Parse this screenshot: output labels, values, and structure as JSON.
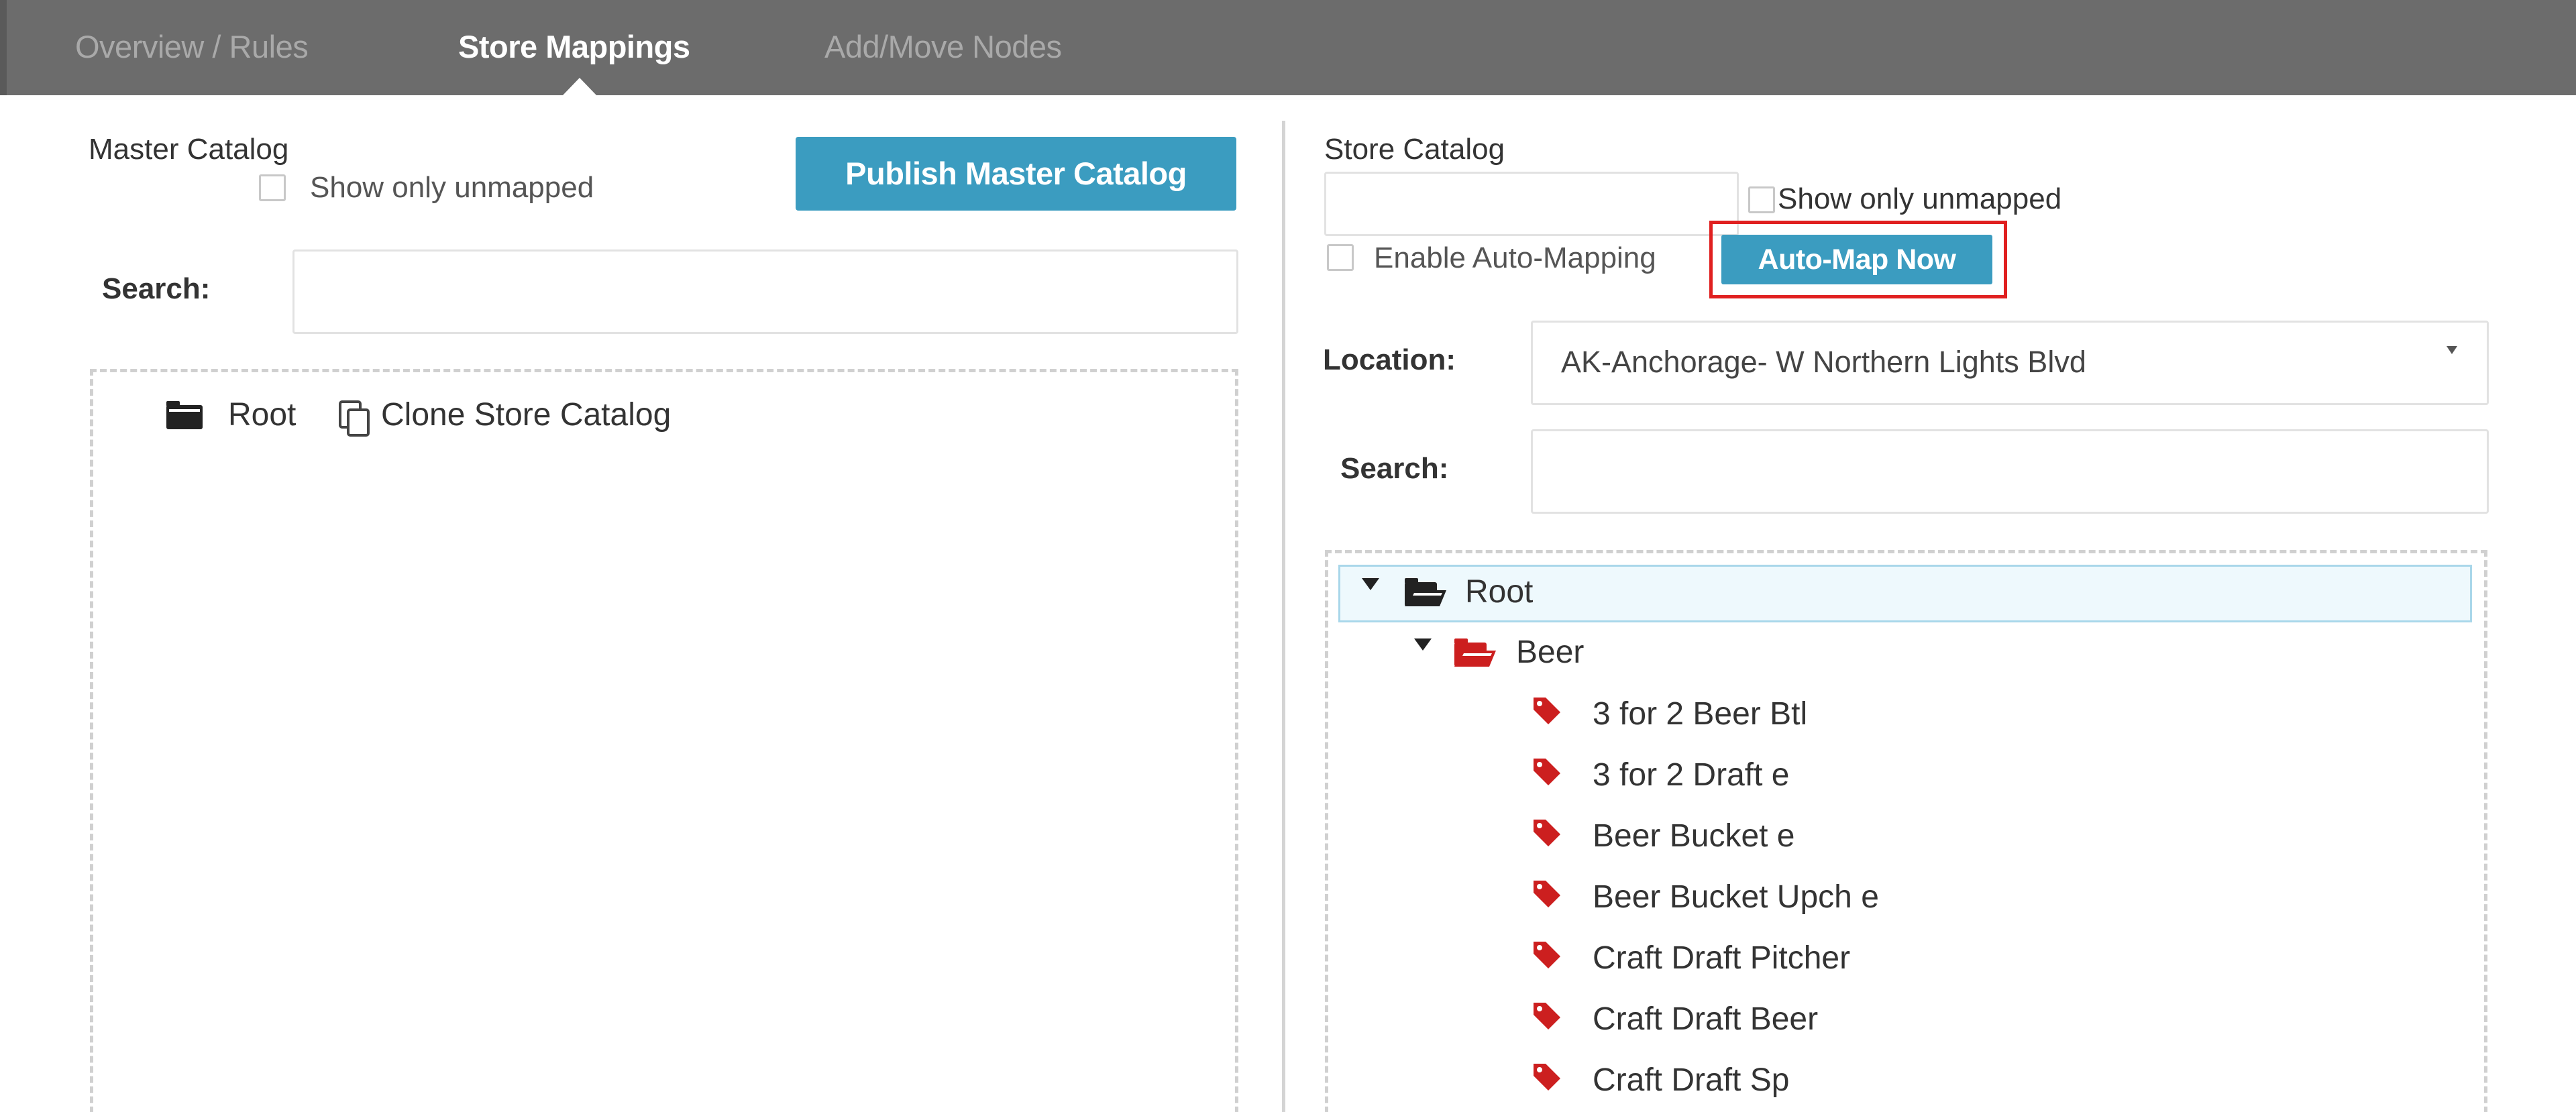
{
  "tabs": [
    {
      "label": "Overview / Rules",
      "active": false
    },
    {
      "label": "Store Mappings",
      "active": true
    },
    {
      "label": "Add/Move Nodes",
      "active": false
    }
  ],
  "master": {
    "title": "Master Catalog",
    "show_unmapped_label": "Show only unmapped",
    "publish_button": "Publish Master Catalog",
    "search_label": "Search:",
    "search_value": "",
    "tree_root": "Root",
    "clone_label": "Clone Store Catalog"
  },
  "store": {
    "title": "Store Catalog",
    "catalog_input_value": "",
    "show_unmapped_label": "Show only unmapped",
    "auto_mapping_label": "Enable Auto-Mapping",
    "auto_map_button": "Auto-Map Now",
    "location_label": "Location:",
    "location_value": "AK-Anchorage- W Northern Lights Blvd",
    "search_label": "Search:",
    "search_value": "",
    "tree": {
      "root": "Root",
      "folder": "Beer",
      "items": [
        "3 for 2 Beer Btl",
        "3 for 2 Draft e",
        "Beer Bucket e",
        "Beer Bucket Upch e",
        "Craft Draft Pitcher",
        "Craft Draft Beer",
        "Craft Draft Sp"
      ]
    }
  },
  "icons": {
    "root_closed": "folder-closed-icon",
    "root_open": "folder-open-icon",
    "beer_folder": "folder-open-icon",
    "item_tag": "tag-icon",
    "clone": "copy-icon",
    "expand": "caret-down-icon",
    "location_dropdown": "chevron-down-icon"
  },
  "colors": {
    "topbar": "#6c6c6c",
    "button": "#3b9cc0",
    "highlight_border": "#e02020",
    "tag": "#cc1f1f",
    "selected_row": "#eef9fd"
  }
}
